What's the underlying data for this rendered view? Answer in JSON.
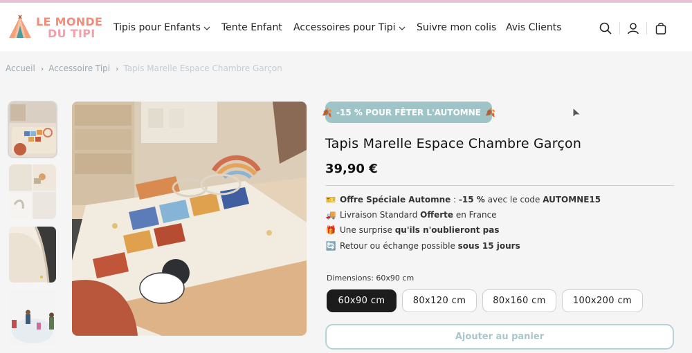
{
  "header": {
    "logo": {
      "line1": "LE MONDE",
      "line2": "DU TIPI"
    },
    "nav": [
      {
        "label": "Tipis pour Enfants",
        "dropdown": true
      },
      {
        "label": "Tente Enfant",
        "dropdown": false
      },
      {
        "label": "Accessoires pour Tipi",
        "dropdown": true
      },
      {
        "label": "Suivre mon colis",
        "dropdown": false
      },
      {
        "label": "Avis Clients",
        "dropdown": false
      }
    ],
    "icons": [
      "search-icon",
      "account-icon",
      "cart-bag-icon"
    ]
  },
  "breadcrumb": [
    "Accueil",
    "Accessoire Tipi",
    "Tapis Marelle Espace Chambre Garçon"
  ],
  "gallery": {
    "thumbnails": [
      "hopscotch rug in room",
      "rug detail closeup",
      "rug edge texture",
      "children playing on rug"
    ],
    "selected_index": 0
  },
  "product": {
    "badge": "-15 % POUR FÊTER L'AUTOMNE",
    "badge_icon": "autumn-leaf-icon",
    "title": "Tapis Marelle Espace Chambre Garçon",
    "price": "39,90 €",
    "features": [
      {
        "icon": "ticket-icon",
        "parts": [
          {
            "b": true,
            "t": "Offre Spéciale Automne"
          },
          {
            "b": false,
            "t": " : "
          },
          {
            "b": true,
            "t": "-15 %"
          },
          {
            "b": false,
            "t": " avec le code "
          },
          {
            "b": true,
            "t": "AUTOMNE15"
          }
        ]
      },
      {
        "icon": "truck-icon",
        "parts": [
          {
            "b": false,
            "t": "Livraison Standard "
          },
          {
            "b": true,
            "t": "Offerte"
          },
          {
            "b": false,
            "t": " en France"
          }
        ]
      },
      {
        "icon": "gift-icon",
        "parts": [
          {
            "b": false,
            "t": "Une surprise "
          },
          {
            "b": true,
            "t": "qu'ils n'oublieront pas"
          }
        ]
      },
      {
        "icon": "exchange-icon",
        "parts": [
          {
            "b": false,
            "t": "Retour ou échange possible "
          },
          {
            "b": true,
            "t": "sous 15 jours"
          }
        ]
      }
    ],
    "dimension_label": "Dimensions: 60x90 cm",
    "dimensions": [
      "60x90 cm",
      "80x120 cm",
      "80x160 cm",
      "100x200 cm"
    ],
    "selected_dimension": "60x90 cm",
    "add_to_cart": "Ajouter au panier"
  },
  "colors": {
    "badge_bg": "#9fc4c8",
    "cart_border": "#b4d3d8",
    "logo_primary": "#f28c78",
    "selected_option": "#1c1c1c"
  }
}
